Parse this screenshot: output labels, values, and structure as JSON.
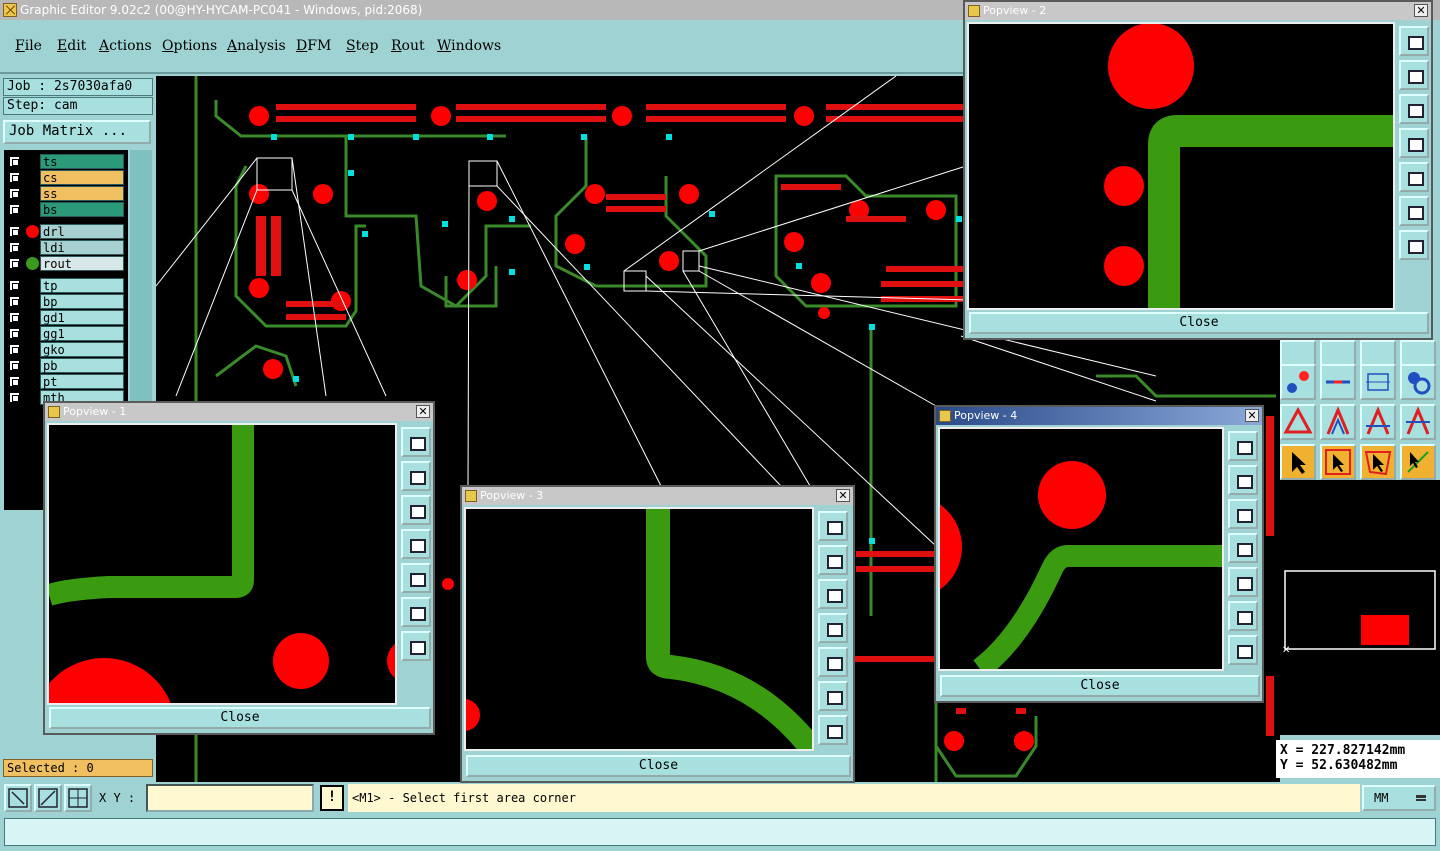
{
  "window": {
    "title": "Graphic Editor 9.02c2 (00@HY-HYCAM-PC041 - Windows, pid:2068)"
  },
  "menu": [
    "File",
    "Edit",
    "Actions",
    "Options",
    "Analysis",
    "DFM",
    "Step",
    "Rout",
    "Windows"
  ],
  "job": {
    "job_label": "Job : 2s7030afa0",
    "step_label": "Step: cam",
    "matrix_button": "Job Matrix ..."
  },
  "layers": [
    {
      "name": "ts",
      "color": "#2a9a78",
      "dot": ""
    },
    {
      "name": "cs",
      "color": "#f0c060",
      "dot": ""
    },
    {
      "name": "ss",
      "color": "#f0c060",
      "dot": ""
    },
    {
      "name": "bs",
      "color": "#2a9a78",
      "dot": ""
    },
    {
      "name": "drl",
      "color": "#a8d0d0",
      "dot": "#ff0000"
    },
    {
      "name": "ldi",
      "color": "#a8d0d0",
      "dot": ""
    },
    {
      "name": "rout",
      "color": "#d8e8e8",
      "dot": "#3a9a20"
    },
    {
      "name": "tp",
      "color": "#a8e0e0",
      "dot": ""
    },
    {
      "name": "bp",
      "color": "#a8e0e0",
      "dot": ""
    },
    {
      "name": "gd1",
      "color": "#a8e0e0",
      "dot": ""
    },
    {
      "name": "gg1",
      "color": "#a8e0e0",
      "dot": ""
    },
    {
      "name": "gko",
      "color": "#a8e0e0",
      "dot": ""
    },
    {
      "name": "pb",
      "color": "#a8e0e0",
      "dot": ""
    },
    {
      "name": "pt",
      "color": "#a8e0e0",
      "dot": ""
    },
    {
      "name": "mth",
      "color": "#a8e0e0",
      "dot": ""
    }
  ],
  "selected": "Selected : 0",
  "coords": {
    "x": "X = 227.827142mm",
    "y": "Y = 52.630482mm"
  },
  "bottom": {
    "xy_label": "X Y :",
    "xy_value": "",
    "excl": "!",
    "prompt": "<M1> - Select first area corner",
    "units": "MM"
  },
  "popviews": [
    {
      "title": "Popview - 2",
      "close": "Close"
    },
    {
      "title": "Popview - 1",
      "close": "Close"
    },
    {
      "title": "Popview - 3",
      "close": "Close"
    },
    {
      "title": "Popview - 4",
      "close": "Close"
    }
  ],
  "colors": {
    "pad": "#ff0000",
    "trace": "#3a9a10",
    "board_outline": "#3a8a2a",
    "via": "#00e0e0",
    "background": "#000000",
    "panel": "#9fd3d3"
  }
}
